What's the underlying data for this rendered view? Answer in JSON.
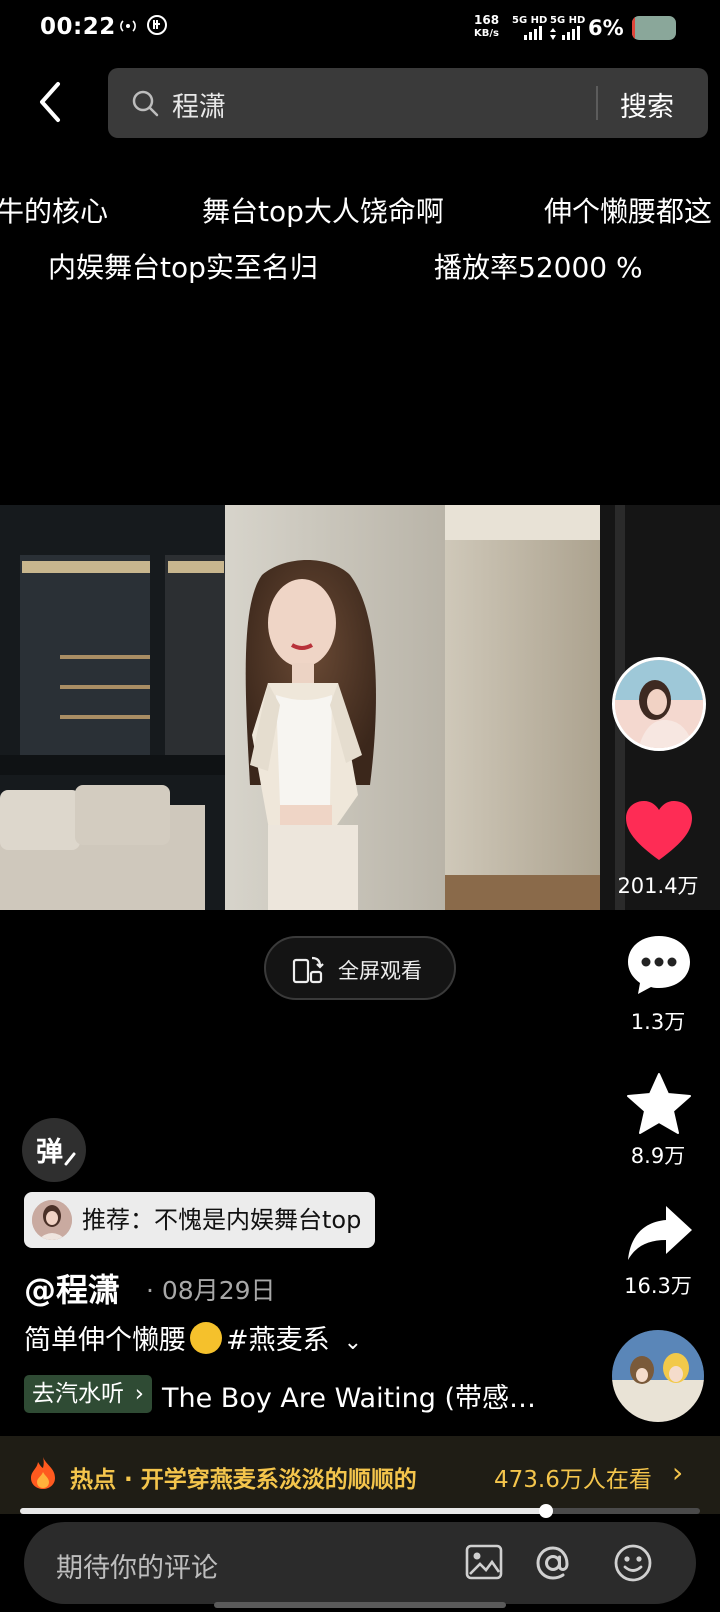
{
  "status": {
    "time": "00:22",
    "net_speed_value": "168",
    "net_speed_unit": "KB/s",
    "sim1": "5G HD",
    "sim2": "5G HD",
    "battery_percent": "6%",
    "battery_level": 0.06
  },
  "search": {
    "query": "程潇",
    "button_label": "搜索"
  },
  "danmaku": [
    "牛的核心",
    "舞台top大人饶命啊",
    "伸个懒腰都这",
    "内娱舞台top实至名归",
    "播放率52000 %"
  ],
  "fullscreen": {
    "label": "全屏观看"
  },
  "actions": {
    "likes": "201.4万",
    "comments": "1.3万",
    "favorites": "8.9万",
    "shares": "16.3万"
  },
  "danmaku_toggle": {
    "label": "弹"
  },
  "recommend": {
    "text": "推荐：不愧是内娱舞台top"
  },
  "post": {
    "author": "@程潇",
    "date": "· 08月29日",
    "desc_before": "简单伸个懒腰",
    "desc_after": "#燕麦系",
    "more": "⌄"
  },
  "music": {
    "tag": "去汽水听",
    "title": "The Boy Are Waiting (带感…"
  },
  "hot": {
    "label": "热点 · 开学穿燕麦系淡淡的顺顺的",
    "count": "473.6万人在看",
    "arrow": "›"
  },
  "progress": {
    "value": 0.774
  },
  "comment": {
    "placeholder": "期待你的评论"
  },
  "colors": {
    "background": "#000000",
    "like": "#fe2c55",
    "hot": "#f4c54c",
    "music_tag": "#2f4b34"
  }
}
